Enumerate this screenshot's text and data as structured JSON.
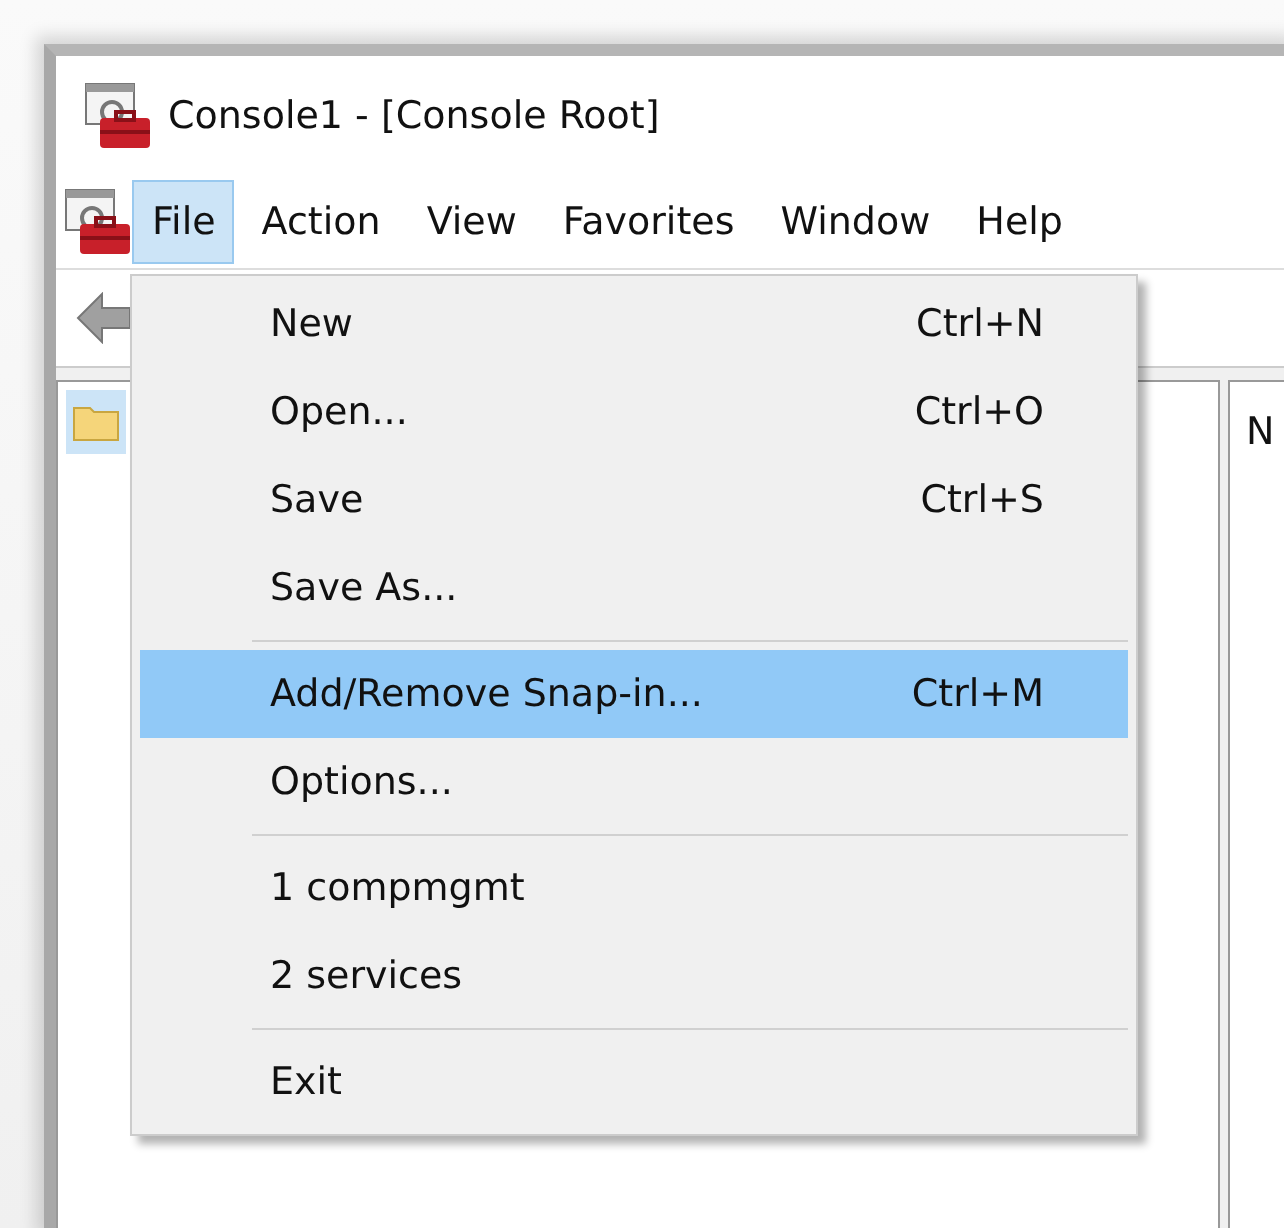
{
  "window": {
    "title": "Console1 - [Console Root]"
  },
  "menu_bar": [
    {
      "label": "File",
      "selected": true
    },
    {
      "label": "Action",
      "selected": false
    },
    {
      "label": "View",
      "selected": false
    },
    {
      "label": "Favorites",
      "selected": false
    },
    {
      "label": "Window",
      "selected": false
    },
    {
      "label": "Help",
      "selected": false
    }
  ],
  "tree": {
    "root_selected": true
  },
  "right_pane": {
    "column_1": "N"
  },
  "file_menu": [
    {
      "kind": "item",
      "label": "New",
      "shortcut": "Ctrl+N",
      "selected": false
    },
    {
      "kind": "item",
      "label": "Open...",
      "shortcut": "Ctrl+O",
      "selected": false
    },
    {
      "kind": "item",
      "label": "Save",
      "shortcut": "Ctrl+S",
      "selected": false
    },
    {
      "kind": "item",
      "label": "Save As...",
      "selected": false
    },
    {
      "kind": "separator"
    },
    {
      "kind": "item",
      "label": "Add/Remove Snap-in...",
      "shortcut": "Ctrl+M",
      "selected": true
    },
    {
      "kind": "item",
      "label": "Options...",
      "selected": false
    },
    {
      "kind": "separator"
    },
    {
      "kind": "item",
      "label": "1 compmgmt",
      "selected": false
    },
    {
      "kind": "item",
      "label": "2 services",
      "selected": false
    },
    {
      "kind": "separator"
    },
    {
      "kind": "item",
      "label": "Exit",
      "selected": false
    }
  ]
}
